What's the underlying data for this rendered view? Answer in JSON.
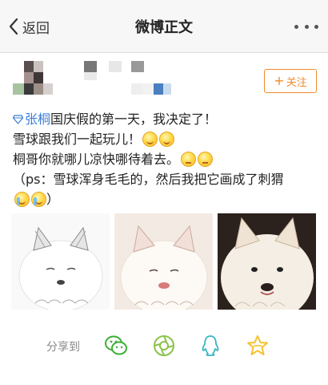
{
  "navbar": {
    "back_label": "返回",
    "title": "微博正文"
  },
  "post": {
    "follow_label": "关注",
    "mention": "张桐",
    "lines": [
      "国庆假的第一天，我决定了！",
      "雪球跟我们一起玩儿！",
      "桐哥你就哪儿凉快哪待着去。",
      "（ps：雪球浑身毛毛的，然后我把它画成了刺猬"
    ],
    "emojis": [
      "smile",
      "smile",
      "think",
      "think",
      "cry",
      "cry"
    ],
    "photos": [
      "white-samoyed-sketch",
      "samoyed-warm",
      "samoyed-photo"
    ]
  },
  "share": {
    "label": "分享到",
    "targets": [
      "wechat-icon",
      "moments-icon",
      "qq-icon",
      "qzone-icon"
    ]
  },
  "colors": {
    "accent_orange": "#f28a2b",
    "link_blue": "#3a7fd6",
    "wechat_green": "#3cb034",
    "moments_green": "#8bc34a",
    "qq_teal": "#38b6c5",
    "qzone_yellow": "#f5c12e"
  }
}
